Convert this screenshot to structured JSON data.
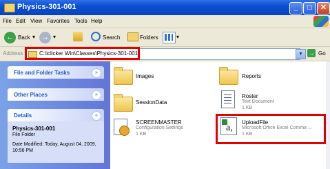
{
  "window": {
    "title": "Physics-301-001"
  },
  "menu": [
    "File",
    "Edit",
    "View",
    "Favorites",
    "Tools",
    "Help"
  ],
  "toolbar": {
    "back": "Back",
    "search": "Search",
    "folders": "Folders"
  },
  "address": {
    "label": "Address",
    "path": "C:\\iclicker Win\\Classes\\Physics-301-001",
    "go": "Go"
  },
  "sidebar": {
    "tasks_title": "File and Folder Tasks",
    "places_title": "Other Places",
    "details_title": "Details",
    "details_name": "Physics-301-001",
    "details_type": "File Folder",
    "details_modified": "Date Modified: Today, August 04, 2009, 10:56 PM"
  },
  "files": [
    {
      "name": "Images",
      "sub1": "",
      "sub2": "",
      "icon": "folder-icon"
    },
    {
      "name": "Reports",
      "sub1": "",
      "sub2": "",
      "icon": "folder-icon"
    },
    {
      "name": "SessionData",
      "sub1": "",
      "sub2": "",
      "icon": "folder-icon"
    },
    {
      "name": "Roster",
      "sub1": "Text Document",
      "sub2": "1 KB",
      "icon": "text-document-icon"
    },
    {
      "name": "SCREENMASTER",
      "sub1": "Configuration Settings",
      "sub2": "1 KB",
      "icon": "config-settings-icon"
    },
    {
      "name": "UploadFile",
      "sub1": "Microsoft Office Excel Comma ...",
      "sub2": "1 KB",
      "icon": "excel-csv-icon"
    }
  ]
}
